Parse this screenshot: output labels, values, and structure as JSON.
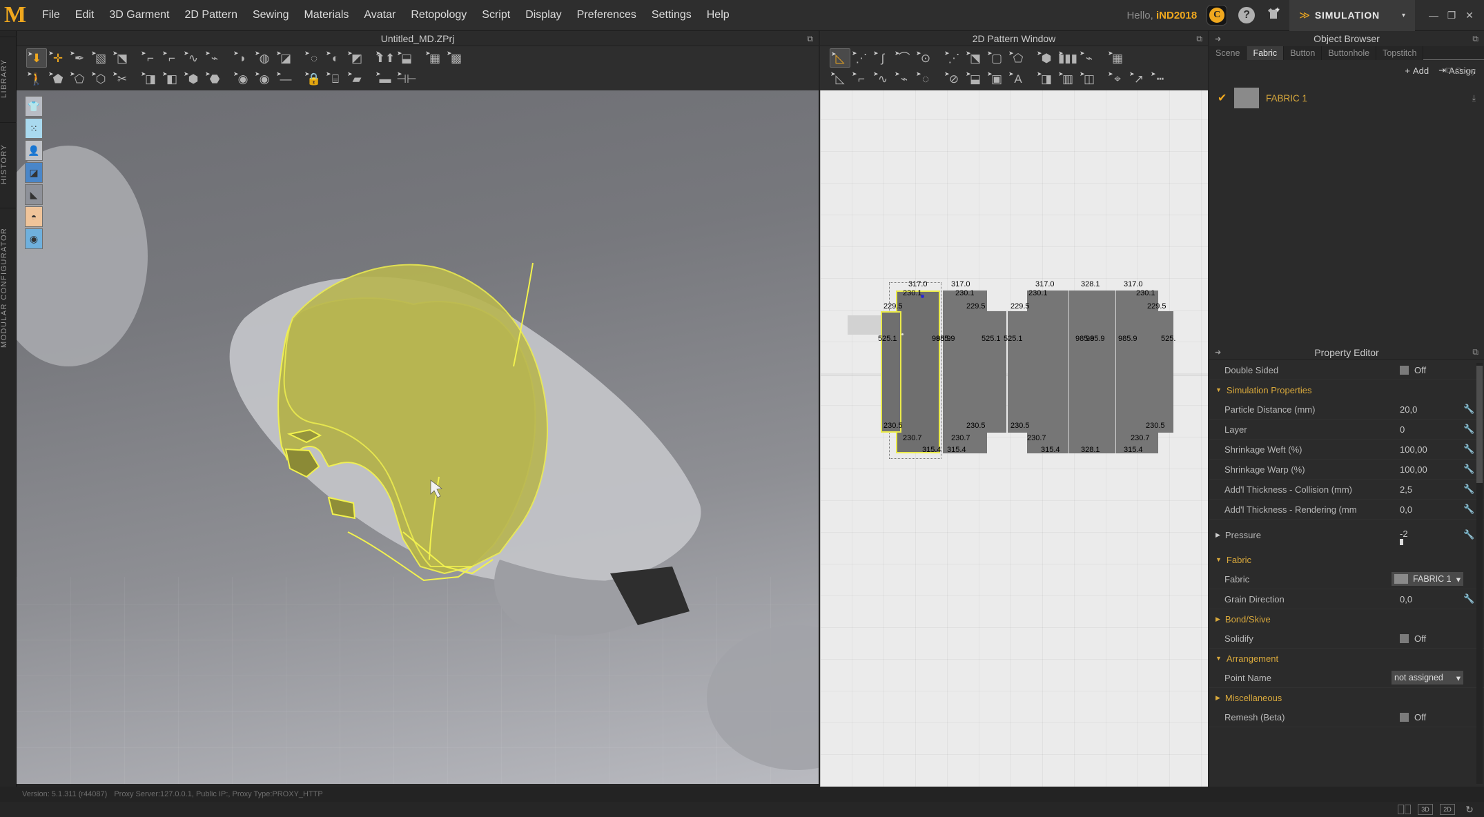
{
  "app": {
    "logo": "M",
    "user_greeting": "Hello,",
    "user_name": "iND2018",
    "mode_label": "SIMULATION",
    "mode_arrow": "▾"
  },
  "menu": {
    "items": [
      {
        "label": "File"
      },
      {
        "label": "Edit"
      },
      {
        "label": "3D Garment"
      },
      {
        "label": "2D Pattern"
      },
      {
        "label": "Sewing"
      },
      {
        "label": "Materials"
      },
      {
        "label": "Avatar"
      },
      {
        "label": "Retopology"
      },
      {
        "label": "Script"
      },
      {
        "label": "Display"
      },
      {
        "label": "Preferences"
      },
      {
        "label": "Settings"
      },
      {
        "label": "Help"
      }
    ]
  },
  "window_controls": {
    "minimize": "—",
    "restore": "❐",
    "close": "✕"
  },
  "left_rail": {
    "tabs": [
      "LIBRARY",
      "HISTORY",
      "MODULAR CONFIGURATOR"
    ]
  },
  "panel_3d": {
    "title": "Untitled_MD.ZPrj",
    "popout_icon": "popout-icon",
    "toolbar_row1": [
      {
        "name": "select-move-down",
        "glyph": "⬇",
        "active": true,
        "gold": true
      },
      {
        "name": "transform-move",
        "glyph": "✛",
        "gold": true
      },
      {
        "name": "brush-select",
        "glyph": "✒"
      },
      {
        "name": "rectangle-select",
        "glyph": "▧"
      },
      {
        "name": "fold-arrange",
        "glyph": "⬔"
      },
      {
        "name": "pin-tool",
        "glyph": "⌐"
      },
      {
        "name": "segment-pin",
        "glyph": "⌐"
      },
      {
        "name": "curve-pin",
        "glyph": "∿"
      },
      {
        "name": "tack-pin",
        "glyph": "⌁"
      },
      {
        "name": "circle-tool",
        "glyph": "◗"
      },
      {
        "name": "fold-arrangement",
        "glyph": "◍"
      },
      {
        "name": "flatten",
        "glyph": "◪"
      },
      {
        "name": "edit-curve",
        "glyph": "◌"
      },
      {
        "name": "deform-mesh",
        "glyph": "◐"
      },
      {
        "name": "attach-tool",
        "glyph": "◩"
      },
      {
        "name": "mirror-garment",
        "glyph": "⬆⬆"
      },
      {
        "name": "symmetric-garment",
        "glyph": "⬓"
      },
      {
        "name": "edit-texture",
        "glyph": "▦"
      },
      {
        "name": "edit-texture-3d",
        "glyph": "▩"
      }
    ],
    "toolbar_row2": [
      {
        "name": "animation-walk",
        "glyph": "🚶"
      },
      {
        "name": "avatar-pose",
        "glyph": "⬟"
      },
      {
        "name": "avatar-skin-offset",
        "glyph": "⬠"
      },
      {
        "name": "avatar-measure",
        "glyph": "⬡"
      },
      {
        "name": "avatar-scissors",
        "glyph": "✂"
      },
      {
        "name": "zipper-tool",
        "glyph": "◨"
      },
      {
        "name": "pleat-tool",
        "glyph": "◧"
      },
      {
        "name": "button-tool",
        "glyph": "⬢"
      },
      {
        "name": "buttonhole-tool",
        "glyph": "⬣"
      },
      {
        "name": "button-place",
        "glyph": "◉"
      },
      {
        "name": "button-big",
        "glyph": "◉"
      },
      {
        "name": "line-tool",
        "glyph": "—"
      },
      {
        "name": "lock-button",
        "glyph": "🔒"
      },
      {
        "name": "topstitch-tool",
        "glyph": "⌸"
      },
      {
        "name": "plane-tool",
        "glyph": "▰"
      },
      {
        "name": "plane-big",
        "glyph": "▬"
      },
      {
        "name": "snap-tool",
        "glyph": "⊣⊢"
      }
    ],
    "viewport_tools": [
      {
        "name": "show-garment-icon",
        "glyph": "👕"
      },
      {
        "name": "show-particles-icon",
        "glyph": "⁙"
      },
      {
        "name": "show-avatar-icon",
        "glyph": "👤"
      },
      {
        "name": "show-surface-icon",
        "glyph": "◪"
      },
      {
        "name": "show-shading-icon",
        "glyph": "◣"
      },
      {
        "name": "show-skin-icon",
        "glyph": "◓"
      },
      {
        "name": "show-environment-icon",
        "glyph": "◉"
      }
    ]
  },
  "status_bar": {
    "version": "Version: 5.1.311 (r44087)",
    "proxy": "Proxy Server:127.0.0.1, Public IP:, Proxy Type:PROXY_HTTP"
  },
  "panel_2d": {
    "title": "2D Pattern Window",
    "popout_icon": "popout-icon",
    "toolbar_row1": [
      {
        "name": "edit-pattern-tool",
        "glyph": "◺",
        "active": true,
        "gold": true
      },
      {
        "name": "edit-point-tool",
        "glyph": "⋰"
      },
      {
        "name": "edit-curve-point-tool",
        "glyph": "∫"
      },
      {
        "name": "edit-curvature-tool",
        "glyph": "⌒"
      },
      {
        "name": "add-point-tool",
        "glyph": "⊙"
      },
      {
        "name": "segment-tool",
        "glyph": "⋰"
      },
      {
        "name": "fold-tool",
        "glyph": "⬔"
      },
      {
        "name": "rectangle-pattern",
        "glyph": "▢"
      },
      {
        "name": "polygon-pattern",
        "glyph": "⬠"
      },
      {
        "name": "inner-shape-tool",
        "glyph": "⬢"
      },
      {
        "name": "pleat-fold-tool",
        "glyph": "▮▮▮"
      },
      {
        "name": "flare-tool",
        "glyph": "⌁"
      },
      {
        "name": "grid-tool",
        "glyph": "▦"
      }
    ],
    "toolbar_row2": [
      {
        "name": "edit-sewing-tool",
        "glyph": "◺"
      },
      {
        "name": "segment-sewing-tool",
        "glyph": "⌐"
      },
      {
        "name": "free-sewing-tool",
        "glyph": "∿"
      },
      {
        "name": "m-n-sewing-tool",
        "glyph": "⌁"
      },
      {
        "name": "auto-sewing-tool",
        "glyph": "◌"
      },
      {
        "name": "check-sewing-tool",
        "glyph": "⊘"
      },
      {
        "name": "baseline-tool",
        "glyph": "⬓"
      },
      {
        "name": "layout-tool",
        "glyph": "▣"
      },
      {
        "name": "text-tool",
        "glyph": "A"
      },
      {
        "name": "graphic-tool",
        "glyph": "◨"
      },
      {
        "name": "trim-tool",
        "glyph": "▥"
      },
      {
        "name": "boolean-tool",
        "glyph": "◫"
      },
      {
        "name": "mark-tool",
        "glyph": "⌖"
      },
      {
        "name": "measure-tool",
        "glyph": "↗"
      },
      {
        "name": "dash-tool",
        "glyph": "┅"
      }
    ]
  },
  "pattern_pieces": [
    {
      "name": "piece-1-selected",
      "selected": true,
      "dims": {
        "top": "317.0",
        "upper_right": "230.1",
        "upper_left": "229.5",
        "left": "525.1",
        "right": "985.9",
        "lower_left": "230.5",
        "lower_right": "230.7",
        "bottom": "315.4"
      }
    },
    {
      "name": "piece-2",
      "selected": false,
      "dims": {
        "top": "317.0",
        "upper_right": "230.1",
        "upper_left": "229.5",
        "left": "985.9",
        "right": "525.1",
        "lower_left": "230.5",
        "lower_right": "230.7",
        "bottom": "315.4"
      }
    },
    {
      "name": "piece-3",
      "selected": false,
      "dims": {
        "top": "317.0",
        "upper_right": "230.1",
        "upper_left": "229.5",
        "left": "525.1",
        "right": "985.9",
        "lower_left": "230.5",
        "lower_right": "230.7",
        "bottom": "315.4"
      }
    },
    {
      "name": "piece-4",
      "selected": false,
      "dims": {
        "top": "328.1",
        "right": "985.9",
        "bottom": "328.1"
      }
    },
    {
      "name": "piece-5",
      "selected": false,
      "dims": {
        "top": "317.0",
        "upper_right": "230.1",
        "upper_left": "229.5",
        "left": "985.9",
        "right": "525.",
        "lower_left": "230.5",
        "lower_right": "230.7",
        "bottom": "315.4"
      }
    }
  ],
  "object_browser": {
    "title": "Object Browser",
    "tabs": [
      {
        "label": "Scene",
        "active": false
      },
      {
        "label": "Fabric",
        "active": true
      },
      {
        "label": "Button",
        "active": false
      },
      {
        "label": "Buttonhole",
        "active": false
      },
      {
        "label": "Topstitch",
        "active": false
      }
    ],
    "actions": [
      {
        "label": "Add",
        "icon": "plus-icon",
        "enabled": true
      },
      {
        "label": "Copy",
        "icon": "copy-icon",
        "enabled": false
      },
      {
        "label": "Assign",
        "icon": "assign-icon",
        "enabled": true
      }
    ],
    "items": [
      {
        "name": "FABRIC 1",
        "checked": true,
        "swatch": "#8a8a8a"
      }
    ]
  },
  "property_editor": {
    "title": "Property Editor",
    "rows": [
      {
        "type": "toggle",
        "name": "double-sided",
        "label": "Double Sided",
        "value": "Off"
      },
      {
        "type": "group",
        "name": "simulation-properties",
        "label": "Simulation Properties",
        "expanded": true
      },
      {
        "type": "value",
        "name": "particle-distance",
        "label": "Particle Distance (mm)",
        "value": "20,0",
        "wrench": true
      },
      {
        "type": "value",
        "name": "layer",
        "label": "Layer",
        "value": "0",
        "wrench": true
      },
      {
        "type": "value",
        "name": "shrinkage-weft",
        "label": "Shrinkage Weft (%)",
        "value": "100,00",
        "wrench": true
      },
      {
        "type": "value",
        "name": "shrinkage-warp",
        "label": "Shrinkage Warp (%)",
        "value": "100,00",
        "wrench": true
      },
      {
        "type": "value",
        "name": "addl-thickness-collision",
        "label": "Add'l Thickness - Collision (mm)",
        "value": "2,5",
        "wrench": true
      },
      {
        "type": "value",
        "name": "addl-thickness-rendering",
        "label": "Add'l Thickness - Rendering (mm",
        "value": "0,0",
        "wrench": true
      },
      {
        "type": "slider-group",
        "name": "pressure",
        "label": "Pressure",
        "value": "-2",
        "expanded": false
      },
      {
        "type": "group",
        "name": "fabric-group",
        "label": "Fabric",
        "expanded": true
      },
      {
        "type": "combo",
        "name": "fabric-select",
        "label": "Fabric",
        "value": "FABRIC 1",
        "swatch": "#8a8a8a"
      },
      {
        "type": "value",
        "name": "grain-direction",
        "label": "Grain Direction",
        "value": "0,0",
        "wrench": true
      },
      {
        "type": "group",
        "name": "bond-skive",
        "label": "Bond/Skive",
        "expanded": false
      },
      {
        "type": "toggle",
        "name": "solidify",
        "label": "Solidify",
        "value": "Off"
      },
      {
        "type": "group",
        "name": "arrangement",
        "label": "Arrangement",
        "expanded": true
      },
      {
        "type": "combo2",
        "name": "point-name",
        "label": "Point Name",
        "value": "not assigned"
      },
      {
        "type": "group",
        "name": "miscellaneous",
        "label": "Miscellaneous",
        "expanded": false
      },
      {
        "type": "toggle",
        "name": "remesh-beta",
        "label": "Remesh (Beta)",
        "value": "Off"
      }
    ]
  },
  "bottom_bar": {
    "buttons": [
      {
        "name": "split-view-button",
        "label": ""
      },
      {
        "name": "view-3d-button",
        "label": "3D"
      },
      {
        "name": "view-2d-button",
        "label": "2D"
      },
      {
        "name": "reset-view-button",
        "label": "↻"
      }
    ]
  },
  "colors": {
    "accent": "#f0a81e",
    "garment": "#b4b24a",
    "selection_outline": "#eaea4a",
    "panel_bg": "#2b2b2b",
    "canvas_2d_bg": "#ebebeb",
    "pattern_fill": "#767676"
  }
}
